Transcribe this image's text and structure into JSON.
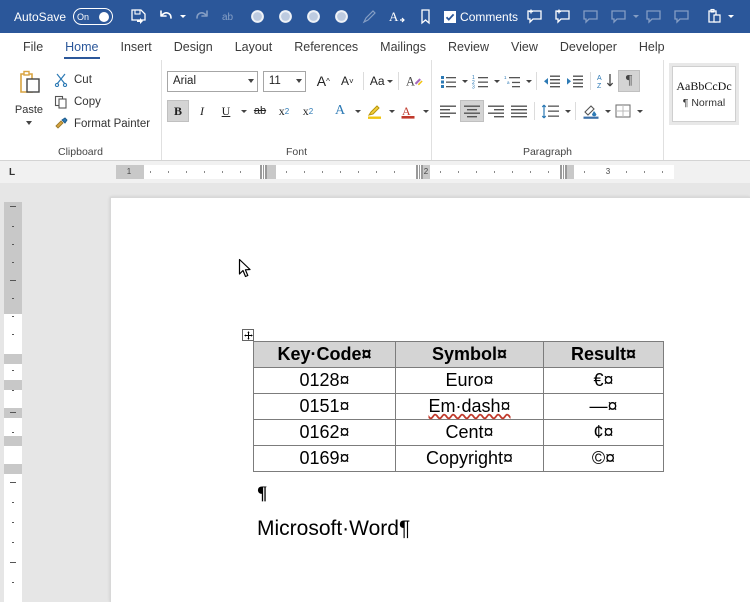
{
  "titlebar": {
    "autosave_label": "AutoSave",
    "autosave_state": "On",
    "comments_label": "Comments",
    "icons": [
      "save-icon",
      "undo-icon",
      "redo-icon",
      "ab-spelling-icon",
      "circle-icon-1",
      "circle-icon-2",
      "circle-icon-3",
      "circle-icon-4",
      "highlighter-icon",
      "text-arrow-icon",
      "bookmark-icon",
      "new-comment-icon",
      "new-comment-2-icon",
      "previous-comment-icon",
      "next-comment-icon",
      "show-comments-icon",
      "reply-comment-icon",
      "clipboard-paste-icon"
    ],
    "background": "#2b579a"
  },
  "tabs": [
    {
      "label": "File",
      "active": false
    },
    {
      "label": "Home",
      "active": true
    },
    {
      "label": "Insert",
      "active": false
    },
    {
      "label": "Design",
      "active": false
    },
    {
      "label": "Layout",
      "active": false
    },
    {
      "label": "References",
      "active": false
    },
    {
      "label": "Mailings",
      "active": false
    },
    {
      "label": "Review",
      "active": false
    },
    {
      "label": "View",
      "active": false
    },
    {
      "label": "Developer",
      "active": false
    },
    {
      "label": "Help",
      "active": false
    }
  ],
  "ribbon": {
    "clipboard": {
      "group_label": "Clipboard",
      "paste_label": "Paste",
      "cut_label": "Cut",
      "copy_label": "Copy",
      "format_painter_label": "Format Painter"
    },
    "font": {
      "group_label": "Font",
      "font_name": "Arial",
      "font_size": "11",
      "grow_font": "A",
      "shrink_font": "A",
      "change_case": "Aa",
      "clear_formatting": "A",
      "bold": "B",
      "italic": "I",
      "underline": "U",
      "strikethrough": "ab",
      "subscript": "x",
      "superscript": "x",
      "text_effects": "A",
      "text_highlight": "A",
      "font_color": "A",
      "bold_active": true
    },
    "paragraph": {
      "group_label": "Paragraph",
      "bullets": "bullet-list-icon",
      "numbering": "numbered-list-icon",
      "multilevel": "multilevel-list-icon",
      "decrease_indent": "decrease-indent-icon",
      "increase_indent": "increase-indent-icon",
      "sort": "sort-az-icon",
      "show_marks": "¶",
      "align_left": "align-left-icon",
      "align_center": "align-center-icon",
      "align_right": "align-right-icon",
      "justify": "justify-icon",
      "line_spacing": "line-spacing-icon",
      "shading": "shading-icon",
      "borders": "borders-icon",
      "show_marks_active": true,
      "align_center_active": true
    },
    "styles": {
      "normal_sample": "AaBbCcDc",
      "normal_name": "¶ Normal"
    }
  },
  "ruler": {
    "tabstop_indicator": "L",
    "horizontal_numbers": [
      "1",
      "2",
      "3"
    ],
    "vertical_visible": true
  },
  "document": {
    "table": {
      "headers": [
        "Key·Code¤",
        "Symbol¤",
        "Result¤"
      ],
      "rows": [
        {
          "code": "0128¤",
          "symbol": "Euro¤",
          "symbol_misspelled": false,
          "result": "€¤"
        },
        {
          "code": "0151¤",
          "symbol": "Em·dash¤",
          "symbol_misspelled": true,
          "result": "—¤"
        },
        {
          "code": "0162¤",
          "symbol": "Cent¤",
          "symbol_misspelled": false,
          "result": "¢¤"
        },
        {
          "code": "0169¤",
          "symbol": "Copyright¤",
          "symbol_misspelled": false,
          "result": "©¤"
        }
      ],
      "end_of_row_mark": "¤"
    },
    "empty_paragraph_mark": "¶",
    "body_line": "Microsoft·Word¶"
  },
  "colors": {
    "title_bar": "#2b579a",
    "accent": "#2b579a",
    "table_header_fill": "#d4d4d4",
    "workspace": "#e6e6e6",
    "spellcheck_underline": "#c0392b"
  }
}
